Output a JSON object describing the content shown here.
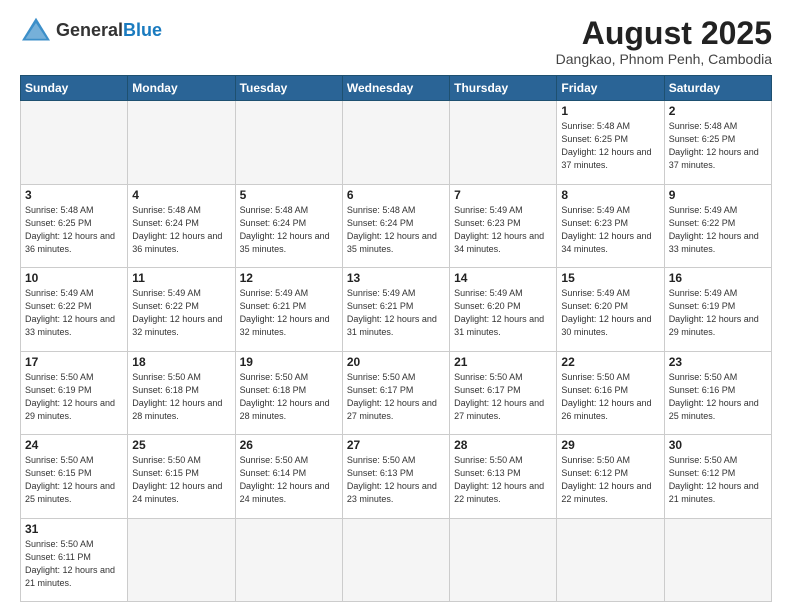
{
  "header": {
    "logo_general": "General",
    "logo_blue": "Blue",
    "month_year": "August 2025",
    "location": "Dangkao, Phnom Penh, Cambodia"
  },
  "weekdays": [
    "Sunday",
    "Monday",
    "Tuesday",
    "Wednesday",
    "Thursday",
    "Friday",
    "Saturday"
  ],
  "weeks": [
    [
      {
        "day": "",
        "info": ""
      },
      {
        "day": "",
        "info": ""
      },
      {
        "day": "",
        "info": ""
      },
      {
        "day": "",
        "info": ""
      },
      {
        "day": "",
        "info": ""
      },
      {
        "day": "1",
        "info": "Sunrise: 5:48 AM\nSunset: 6:25 PM\nDaylight: 12 hours\nand 37 minutes."
      },
      {
        "day": "2",
        "info": "Sunrise: 5:48 AM\nSunset: 6:25 PM\nDaylight: 12 hours\nand 37 minutes."
      }
    ],
    [
      {
        "day": "3",
        "info": "Sunrise: 5:48 AM\nSunset: 6:25 PM\nDaylight: 12 hours\nand 36 minutes."
      },
      {
        "day": "4",
        "info": "Sunrise: 5:48 AM\nSunset: 6:24 PM\nDaylight: 12 hours\nand 36 minutes."
      },
      {
        "day": "5",
        "info": "Sunrise: 5:48 AM\nSunset: 6:24 PM\nDaylight: 12 hours\nand 35 minutes."
      },
      {
        "day": "6",
        "info": "Sunrise: 5:48 AM\nSunset: 6:24 PM\nDaylight: 12 hours\nand 35 minutes."
      },
      {
        "day": "7",
        "info": "Sunrise: 5:49 AM\nSunset: 6:23 PM\nDaylight: 12 hours\nand 34 minutes."
      },
      {
        "day": "8",
        "info": "Sunrise: 5:49 AM\nSunset: 6:23 PM\nDaylight: 12 hours\nand 34 minutes."
      },
      {
        "day": "9",
        "info": "Sunrise: 5:49 AM\nSunset: 6:22 PM\nDaylight: 12 hours\nand 33 minutes."
      }
    ],
    [
      {
        "day": "10",
        "info": "Sunrise: 5:49 AM\nSunset: 6:22 PM\nDaylight: 12 hours\nand 33 minutes."
      },
      {
        "day": "11",
        "info": "Sunrise: 5:49 AM\nSunset: 6:22 PM\nDaylight: 12 hours\nand 32 minutes."
      },
      {
        "day": "12",
        "info": "Sunrise: 5:49 AM\nSunset: 6:21 PM\nDaylight: 12 hours\nand 32 minutes."
      },
      {
        "day": "13",
        "info": "Sunrise: 5:49 AM\nSunset: 6:21 PM\nDaylight: 12 hours\nand 31 minutes."
      },
      {
        "day": "14",
        "info": "Sunrise: 5:49 AM\nSunset: 6:20 PM\nDaylight: 12 hours\nand 31 minutes."
      },
      {
        "day": "15",
        "info": "Sunrise: 5:49 AM\nSunset: 6:20 PM\nDaylight: 12 hours\nand 30 minutes."
      },
      {
        "day": "16",
        "info": "Sunrise: 5:49 AM\nSunset: 6:19 PM\nDaylight: 12 hours\nand 29 minutes."
      }
    ],
    [
      {
        "day": "17",
        "info": "Sunrise: 5:50 AM\nSunset: 6:19 PM\nDaylight: 12 hours\nand 29 minutes."
      },
      {
        "day": "18",
        "info": "Sunrise: 5:50 AM\nSunset: 6:18 PM\nDaylight: 12 hours\nand 28 minutes."
      },
      {
        "day": "19",
        "info": "Sunrise: 5:50 AM\nSunset: 6:18 PM\nDaylight: 12 hours\nand 28 minutes."
      },
      {
        "day": "20",
        "info": "Sunrise: 5:50 AM\nSunset: 6:17 PM\nDaylight: 12 hours\nand 27 minutes."
      },
      {
        "day": "21",
        "info": "Sunrise: 5:50 AM\nSunset: 6:17 PM\nDaylight: 12 hours\nand 27 minutes."
      },
      {
        "day": "22",
        "info": "Sunrise: 5:50 AM\nSunset: 6:16 PM\nDaylight: 12 hours\nand 26 minutes."
      },
      {
        "day": "23",
        "info": "Sunrise: 5:50 AM\nSunset: 6:16 PM\nDaylight: 12 hours\nand 25 minutes."
      }
    ],
    [
      {
        "day": "24",
        "info": "Sunrise: 5:50 AM\nSunset: 6:15 PM\nDaylight: 12 hours\nand 25 minutes."
      },
      {
        "day": "25",
        "info": "Sunrise: 5:50 AM\nSunset: 6:15 PM\nDaylight: 12 hours\nand 24 minutes."
      },
      {
        "day": "26",
        "info": "Sunrise: 5:50 AM\nSunset: 6:14 PM\nDaylight: 12 hours\nand 24 minutes."
      },
      {
        "day": "27",
        "info": "Sunrise: 5:50 AM\nSunset: 6:13 PM\nDaylight: 12 hours\nand 23 minutes."
      },
      {
        "day": "28",
        "info": "Sunrise: 5:50 AM\nSunset: 6:13 PM\nDaylight: 12 hours\nand 22 minutes."
      },
      {
        "day": "29",
        "info": "Sunrise: 5:50 AM\nSunset: 6:12 PM\nDaylight: 12 hours\nand 22 minutes."
      },
      {
        "day": "30",
        "info": "Sunrise: 5:50 AM\nSunset: 6:12 PM\nDaylight: 12 hours\nand 21 minutes."
      }
    ],
    [
      {
        "day": "31",
        "info": "Sunrise: 5:50 AM\nSunset: 6:11 PM\nDaylight: 12 hours\nand 21 minutes."
      },
      {
        "day": "",
        "info": ""
      },
      {
        "day": "",
        "info": ""
      },
      {
        "day": "",
        "info": ""
      },
      {
        "day": "",
        "info": ""
      },
      {
        "day": "",
        "info": ""
      },
      {
        "day": "",
        "info": ""
      }
    ]
  ]
}
